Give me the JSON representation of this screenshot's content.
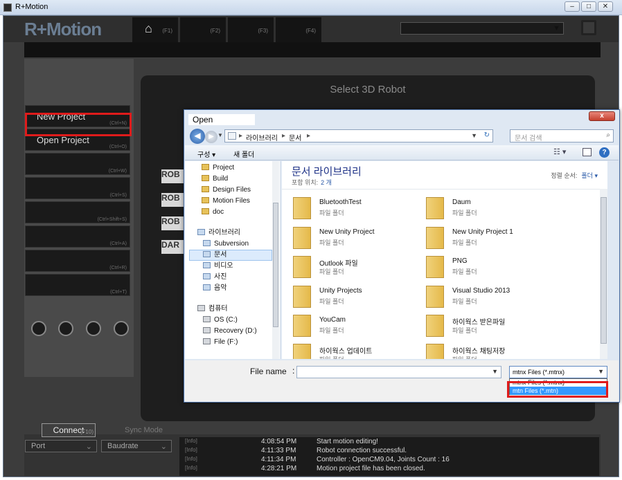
{
  "window": {
    "title": "R+Motion",
    "minimize": "–",
    "maximize": "□",
    "close": "✕"
  },
  "app": {
    "logo": "R+Motion",
    "tabs": [
      {
        "icon": "home-icon",
        "label": "(F1)"
      },
      {
        "label": "(F2)"
      },
      {
        "label": "(F3)"
      },
      {
        "label": "(F4)"
      }
    ],
    "left_menu": [
      {
        "label": "New Project",
        "shortcut": "(Ctrl+N)"
      },
      {
        "label": "Open Project",
        "shortcut": "(Ctrl+O)"
      },
      {
        "label": "",
        "shortcut": "(Ctrl+W)"
      },
      {
        "label": "",
        "shortcut": "(Ctrl+S)"
      },
      {
        "label": "",
        "shortcut": "(Ctrl+Shift+S)"
      },
      {
        "label": "",
        "shortcut": "(Ctrl+A)"
      },
      {
        "label": "",
        "shortcut": "(Ctrl+R)"
      },
      {
        "label": "",
        "shortcut": "(Ctrl+T)"
      }
    ],
    "select_robot_title": "Select 3D Robot",
    "robot_labels": [
      "ROB",
      "ROB",
      "ROB",
      "DAR"
    ],
    "bottom": {
      "connect_label": "Connect",
      "connect_shortcut": "(F10)",
      "sync_mode": "Sync Mode",
      "port_label": "Port",
      "baudrate_label": "Baudrate"
    },
    "log": [
      {
        "type": "[Info]",
        "time": "4:08:54 PM",
        "msg": "Start motion editing!"
      },
      {
        "type": "[Info]",
        "time": "4:11:33 PM",
        "msg": "Robot connection successful."
      },
      {
        "type": "[Info]",
        "time": "4:11:34 PM",
        "msg": "Controller : OpenCM9.04, Joints Count : 16"
      },
      {
        "type": "[Info]",
        "time": "4:28:21 PM",
        "msg": "Motion project file has been closed."
      }
    ]
  },
  "dialog": {
    "title": "Open",
    "close": "x",
    "path": [
      "라이브러리",
      "문서"
    ],
    "search_placeholder": "문서 검색",
    "organize": "구성 ▾",
    "new_folder": "새 폴더",
    "help": "?",
    "nav_items": [
      {
        "label": "Project",
        "kind": "folder"
      },
      {
        "label": "Build",
        "kind": "folder"
      },
      {
        "label": "Design Files",
        "kind": "folder"
      },
      {
        "label": "Motion Files",
        "kind": "folder"
      },
      {
        "label": "doc",
        "kind": "folder"
      },
      {
        "label": "라이브러리",
        "kind": "library"
      },
      {
        "label": "Subversion",
        "kind": "library"
      },
      {
        "label": "문서",
        "kind": "library"
      },
      {
        "label": "비디오",
        "kind": "library"
      },
      {
        "label": "사진",
        "kind": "library"
      },
      {
        "label": "음악",
        "kind": "library"
      },
      {
        "label": "컴퓨터",
        "kind": "drive"
      },
      {
        "label": "OS (C:)",
        "kind": "drive"
      },
      {
        "label": "Recovery (D:)",
        "kind": "drive"
      },
      {
        "label": "File (F:)",
        "kind": "drive"
      }
    ],
    "library_title": "문서 라이브러리",
    "library_sub": "포함 위치:",
    "library_count": "2 개",
    "sort_label": "정렬 순서:",
    "sort_value": "폴더 ▾",
    "items": [
      {
        "name": "BluetoothTest",
        "type": "파일 폴더"
      },
      {
        "name": "Daum",
        "type": "파일 폴더"
      },
      {
        "name": "New Unity Project",
        "type": "파일 폴더"
      },
      {
        "name": "New Unity Project 1",
        "type": "파일 폴더"
      },
      {
        "name": "Outlook 파일",
        "type": "파일 폴더"
      },
      {
        "name": "PNG",
        "type": "파일 폴더"
      },
      {
        "name": "Unity Projects",
        "type": "파일 폴더"
      },
      {
        "name": "Visual Studio 2013",
        "type": "파일 폴더"
      },
      {
        "name": "YouCam",
        "type": "파일 폴더"
      },
      {
        "name": "하이웍스 받은파일",
        "type": "파일 폴더"
      },
      {
        "name": "하이웍스 업데이트",
        "type": "파일 폴더"
      },
      {
        "name": "하이웍스 채팅저장",
        "type": "파일 폴더"
      }
    ],
    "filename_label": "File name",
    "filename_value": "",
    "filetype_selected": "mtnx Files (*.mtnx)",
    "filetype_options": [
      "mtnx Files (*.mtnx)",
      "mtn Files (*.mtn)"
    ]
  },
  "colors": {
    "highlight_red": "#e01b1b",
    "selection_blue": "#3399ff"
  }
}
